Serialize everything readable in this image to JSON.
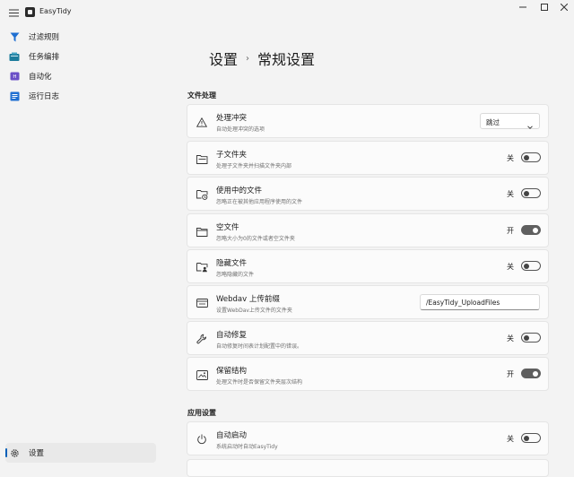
{
  "app": {
    "title": "EasyTidy",
    "window_controls": [
      "minimize-icon",
      "maximize-icon",
      "close-icon"
    ]
  },
  "nav": {
    "items": [
      {
        "label": "过滤规则",
        "icon": "filter-icon",
        "color": "#1f6fd1"
      },
      {
        "label": "任务编排",
        "icon": "task-orchestration-icon",
        "color": "#1c7c9c"
      },
      {
        "label": "自动化",
        "icon": "automation-icon",
        "color": "#6a4fc7"
      },
      {
        "label": "运行日志",
        "icon": "log-icon",
        "color": "#1f6fd1"
      }
    ],
    "settings_label": "设置"
  },
  "header": {
    "parent": "设置",
    "separator": "›",
    "current": "常规设置"
  },
  "sections": [
    {
      "title": "文件处理",
      "items": [
        {
          "title": "处理冲突",
          "desc": "自动处理冲突的选项",
          "icon": "warning-icon",
          "control": "dropdown",
          "value": "跳过"
        },
        {
          "title": "子文件夹",
          "desc": "处理子文件夹并扫描文件夹内部",
          "icon": "subfolder-icon",
          "control": "toggle",
          "state_label": "关",
          "on": false
        },
        {
          "title": "使用中的文件",
          "desc": "忽略正在被其他应用程序使用的文件",
          "icon": "folder-in-use-icon",
          "control": "toggle",
          "state_label": "关",
          "on": false
        },
        {
          "title": "空文件",
          "desc": "忽略大小为0的文件或者空文件夹",
          "icon": "empty-folder-icon",
          "control": "toggle",
          "state_label": "开",
          "on": true
        },
        {
          "title": "隐藏文件",
          "desc": "忽略隐藏的文件",
          "icon": "hidden-file-icon",
          "control": "toggle",
          "state_label": "关",
          "on": false
        },
        {
          "title": "Webdav 上传前缀",
          "desc": "设置WebDav上传文件的文件夹",
          "icon": "webdav-icon",
          "control": "input",
          "value": "/EasyTidy_UploadFiles"
        },
        {
          "title": "自动修复",
          "desc": "自动修复时间表计划配置中的错误。",
          "icon": "wrench-icon",
          "control": "toggle",
          "state_label": "关",
          "on": false
        },
        {
          "title": "保留结构",
          "desc": "处理文件时是否保留文件夹层次结构",
          "icon": "structure-icon",
          "control": "toggle",
          "state_label": "开",
          "on": true
        }
      ]
    },
    {
      "title": "应用设置",
      "items": [
        {
          "title": "自动启动",
          "desc": "系统启动时自动EasyTidy",
          "icon": "power-icon",
          "control": "toggle",
          "state_label": "关",
          "on": false
        }
      ]
    }
  ]
}
